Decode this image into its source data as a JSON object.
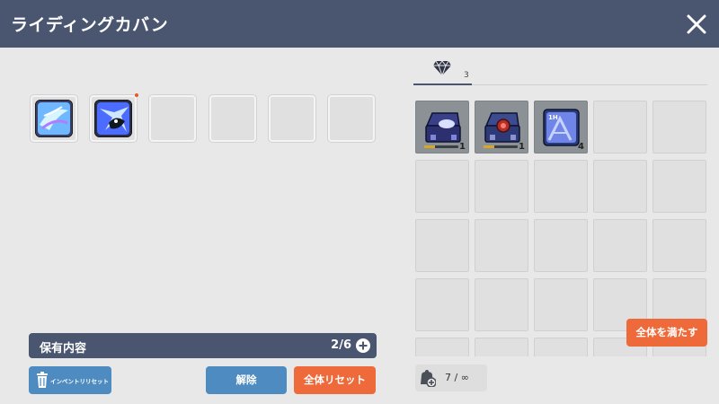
{
  "header": {
    "title": "ライディングカバン",
    "close_icon": "close-icon"
  },
  "equip_slots": [
    {
      "filled": true,
      "icon": "mount-skill-icon-1",
      "badge": false
    },
    {
      "filled": true,
      "icon": "mount-skill-icon-2",
      "badge": true
    },
    {
      "filled": false
    },
    {
      "filled": false
    },
    {
      "filled": false
    },
    {
      "filled": false
    }
  ],
  "owned": {
    "label": "保有内容",
    "count": "2/6",
    "plus_icon": "plus-circle-icon"
  },
  "buttons": {
    "inventory_reset": "インベントリリセット",
    "release": "解除",
    "all_reset": "全体リセット",
    "fill_all": "全体を満たす"
  },
  "tab": {
    "icon": "diamond-icon",
    "count": "3"
  },
  "inventory_items": [
    {
      "icon": "blue-treasure-box-icon",
      "qty": "1"
    },
    {
      "icon": "red-treasure-box-icon",
      "qty": "1"
    },
    {
      "icon": "1h-ticket-icon",
      "qty": "4"
    }
  ],
  "capacity": {
    "icon": "bag-plus-icon",
    "value": "7 / ∞"
  },
  "colors": {
    "header_bg": "#4a5670",
    "blue_button": "#4e8bc0",
    "orange_button": "#ef6a3a"
  }
}
